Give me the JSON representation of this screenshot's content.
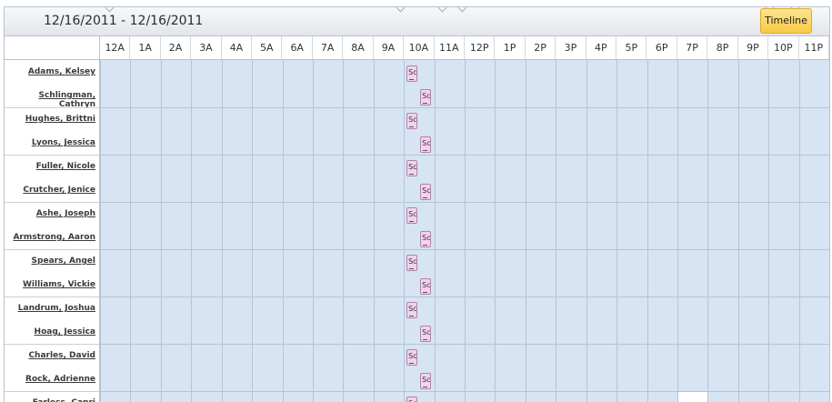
{
  "header": {
    "date_range": "12/16/2011 - 12/16/2011",
    "timeline_label": "Timeline"
  },
  "hours": [
    "12A",
    "1A",
    "2A",
    "3A",
    "4A",
    "5A",
    "6A",
    "7A",
    "8A",
    "9A",
    "10A",
    "11A",
    "12P",
    "1P",
    "2P",
    "3P",
    "4P",
    "5P",
    "6P",
    "7P",
    "8P",
    "9P",
    "10P",
    "11P"
  ],
  "resources": [
    {
      "name": "Adams, Kelsey",
      "appointment": "Sc"
    },
    {
      "name": "Schlingman, Cathryn",
      "appointment": "Sc"
    },
    {
      "name": "Hughes, Brittni",
      "appointment": "Sc"
    },
    {
      "name": "Lyons, Jessica",
      "appointment": "Sc"
    },
    {
      "name": "Fuller, Nicole",
      "appointment": "Sc"
    },
    {
      "name": "Crutcher, Jenice",
      "appointment": "Sc"
    },
    {
      "name": "Ashe, Joseph",
      "appointment": "Sc"
    },
    {
      "name": "Armstrong, Aaron",
      "appointment": "Sc"
    },
    {
      "name": "Spears, Angel",
      "appointment": "Sc"
    },
    {
      "name": "Williams, Vickie",
      "appointment": "Sc"
    },
    {
      "name": "Landrum, Joshua",
      "appointment": "Sc"
    },
    {
      "name": "Hoag, Jessica",
      "appointment": "Sc"
    },
    {
      "name": "Charles, David",
      "appointment": "Sc"
    },
    {
      "name": "Rock, Adrienne",
      "appointment": "Sc"
    },
    {
      "name": "Farless, Capri",
      "appointment": "Sc"
    }
  ],
  "appointment_hour": "10A",
  "colors": {
    "grid_bg": "#d6e4f3",
    "appointment_bg": "#f2d3ee",
    "timeline_button": "#f8c944"
  }
}
